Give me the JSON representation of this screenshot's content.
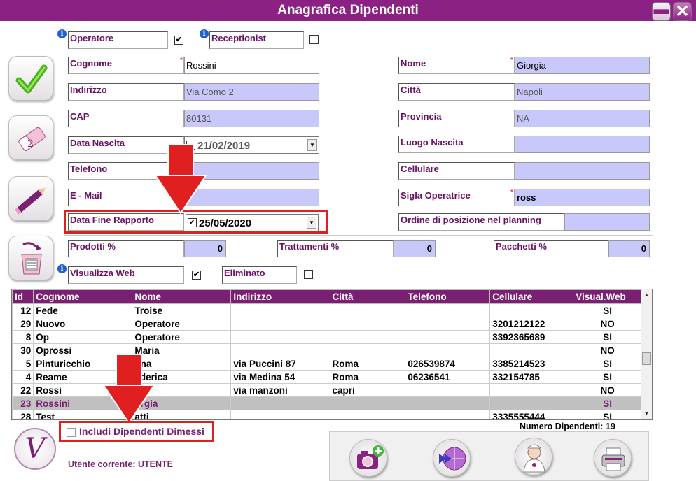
{
  "window": {
    "title": "Anagrafica Dipendenti",
    "minimize_glyph": "▬",
    "close_glyph": "✕"
  },
  "flags": {
    "operatore_label": "Operatore",
    "operatore_checked": "✔",
    "receptionist_label": "Receptionist",
    "receptionist_checked": ""
  },
  "form": {
    "cognome_label": "Cognome",
    "cognome_value": "Rossini",
    "nome_label": "Nome",
    "nome_value": "Giorgia",
    "indirizzo_label": "Indirizzo",
    "indirizzo_value": "Via Como 2",
    "citta_label": "Città",
    "citta_value": "Napoli",
    "cap_label": "CAP",
    "cap_value": "80131",
    "provincia_label": "Provincia",
    "provincia_value": "NA",
    "data_nascita_label": "Data Nascita",
    "data_nascita_value": "21/02/2019",
    "luogo_nascita_label": "Luogo Nascita",
    "luogo_nascita_value": "",
    "telefono_label": "Telefono",
    "telefono_value": "",
    "cellulare_label": "Cellulare",
    "cellulare_value": "",
    "email_label": "E - Mail",
    "email_value": "",
    "sigla_label": "Sigla Operatrice",
    "sigla_value": "ross",
    "data_fine_label": "Data Fine Rapporto",
    "data_fine_value": "25/05/2020",
    "data_fine_checked": "✔",
    "ordine_label": "Ordine di posizione nel planning",
    "ordine_value": "",
    "prodotti_label": "Prodotti %",
    "prodotti_value": "0",
    "trattamenti_label": "Trattamenti %",
    "trattamenti_value": "0",
    "pacchetti_label": "Pacchetti %",
    "pacchetti_value": "0",
    "visualizza_web_label": "Visualizza Web",
    "visualizza_web_checked": "✔",
    "eliminato_label": "Eliminato",
    "eliminato_checked": ""
  },
  "grid": {
    "columns": [
      "Id",
      "Cognome",
      "Nome",
      "Indirizzo",
      "Città",
      "Telefono",
      "Cellulare",
      "Visual.Web"
    ],
    "rows": [
      [
        "12",
        "Fede",
        "Troise",
        "",
        "",
        "",
        "",
        "SI"
      ],
      [
        "29",
        "Nuovo",
        "Operatore",
        "",
        "",
        "",
        "3201212122",
        "NO"
      ],
      [
        "8",
        "Op",
        "Operatore",
        "",
        "",
        "",
        "3392365689",
        "SI"
      ],
      [
        "30",
        "Oprossi",
        "Maria",
        "",
        "",
        "",
        "",
        "NO"
      ],
      [
        "5",
        "Pinturicchio",
        "ona",
        "via Puccini 87",
        "Roma",
        "026539874",
        "3385214523",
        "SI"
      ],
      [
        "4",
        "Reame",
        "ederica",
        "via Medina 54",
        "Roma",
        "06236541",
        "332154785",
        "SI"
      ],
      [
        "22",
        "Rossi",
        "a",
        "via manzoni",
        "capri",
        "",
        "",
        "NO"
      ],
      [
        "23",
        "Rossini",
        "orgia",
        "",
        "",
        "",
        "",
        "SI"
      ],
      [
        "28",
        "Test",
        "atti",
        "",
        "",
        "",
        "3335555444",
        "SI"
      ]
    ],
    "selected_index": 7
  },
  "footer": {
    "includi_label": "Includi Dipendenti Dimessi",
    "numero_label": "Numero Dipendenti: 19",
    "utente_label": "Utente corrente: UTENTE"
  },
  "icons": {
    "info": "i",
    "logo_letter": "V",
    "dropdown": "▼",
    "scroll_up": "▲",
    "scroll_down": "▼"
  },
  "colors": {
    "brand_purple": "#8b2283",
    "field_lavender": "#c8c8fa",
    "annotation_red": "#e02020"
  }
}
